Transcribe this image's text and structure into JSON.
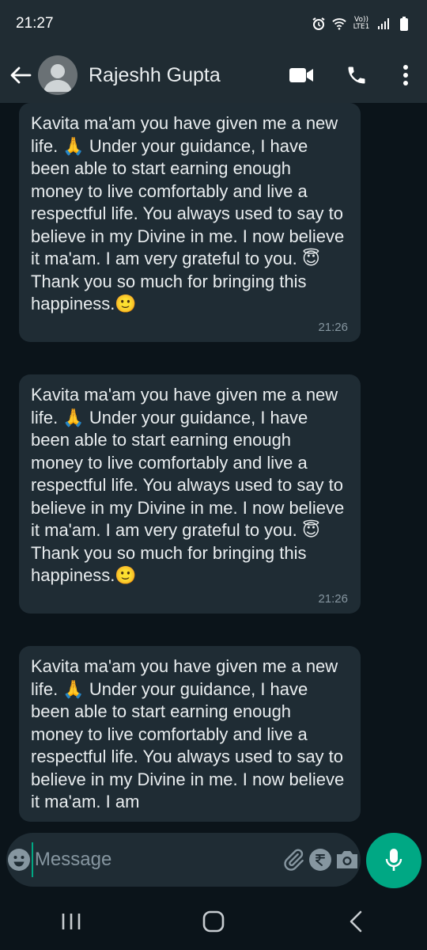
{
  "status_bar": {
    "time": "21:27",
    "icons": [
      "alarm-icon",
      "wifi-icon",
      "volte-lte-icon",
      "signal-icon",
      "battery-icon"
    ],
    "network_label_top": "Vo))",
    "network_label_bottom": "LTE1"
  },
  "header": {
    "contact_name": "Rajeshh Gupta",
    "icons": [
      "back-arrow-icon",
      "avatar",
      "video-call-icon",
      "phone-call-icon",
      "more-options-icon"
    ]
  },
  "messages": [
    {
      "text": "Kavita ma'am you have given me a new life. 🙏 Under your guidance, I have been able to start earning enough money to live comfortably and live a respectful life. You always used to say to believe in my Divine in me. I now believe it ma'am. I am very grateful to you. 😇Thank you so much for bringing this happiness.🙂",
      "time": "21:26"
    },
    {
      "text": "Kavita ma'am you have given me a new life. 🙏 Under your guidance, I have been able to start earning enough money to live comfortably and live a respectful life. You always used to say to believe in my Divine in me. I now believe it ma'am. I am very grateful to you. 😇Thank you so much for bringing this happiness.🙂",
      "time": "21:26"
    },
    {
      "text": "Kavita ma'am you have given me a new life. 🙏 Under your guidance, I have been able to start earning enough money to live comfortably and live a respectful life. You always used to say to believe in my Divine in me. I now believe it ma'am. I am",
      "time": ""
    }
  ],
  "composer": {
    "placeholder": "Message",
    "icons": [
      "emoji-icon",
      "attachment-icon",
      "rupee-payment-icon",
      "camera-icon",
      "microphone-icon"
    ]
  },
  "nav_bar": {
    "icons": [
      "recent-apps-icon",
      "home-icon",
      "back-icon"
    ]
  },
  "colors": {
    "header_bg": "#202c33",
    "chat_bg": "#0b141a",
    "bubble_bg": "#1f2c34",
    "accent": "#00a884",
    "text_primary": "#e9edef",
    "text_secondary": "#8696a0"
  }
}
